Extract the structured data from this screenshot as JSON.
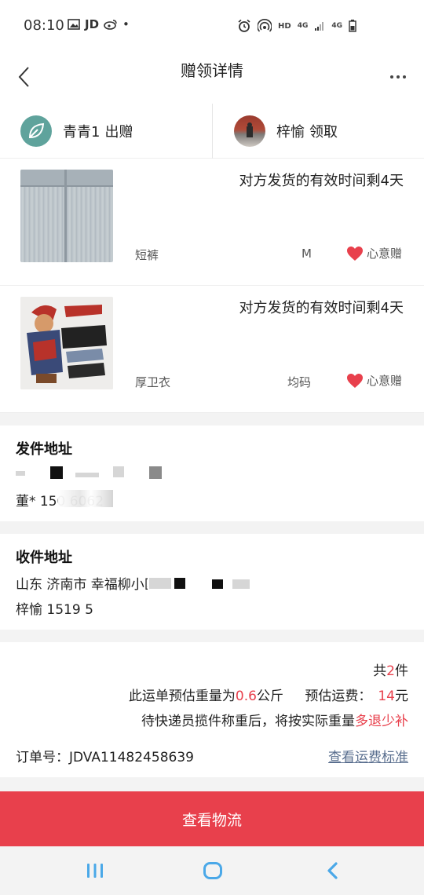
{
  "status_bar": {
    "time": "08:10",
    "left_icons": [
      "image-icon",
      "JD",
      "weibo-icon",
      "•"
    ],
    "right_icons": [
      "alarm-icon",
      "hotspot-icon",
      "HD",
      "4G",
      "4G",
      "battery-icon"
    ]
  },
  "nav": {
    "title": "赠领详情"
  },
  "giver": {
    "name": "青青1",
    "action": "出赠"
  },
  "receiver": {
    "name": "梓愉",
    "action": "领取"
  },
  "items": [
    {
      "note": "对方发货的有效时间剩4天",
      "name": "短裤",
      "size": "M",
      "tag": "心意赠"
    },
    {
      "note": "对方发货的有效时间剩4天",
      "name": "厚卫衣",
      "size": "均码",
      "tag": "心意赠"
    }
  ],
  "sender": {
    "title": "发件地址",
    "address": "",
    "contact": "董* 150  6062"
  },
  "recipient": {
    "title": "收件地址",
    "address_prefix": "山东 济南市 幸福柳小区17号楼",
    "address_suffix": "201",
    "contact": "梓愉 1519      5"
  },
  "shipping": {
    "count_prefix": "共",
    "count": "2",
    "count_suffix": "件",
    "weight_prefix": "此运单预估重量为",
    "weight": "0.6",
    "weight_unit": "公斤",
    "fee_label": "预估运费：",
    "fee": "14",
    "fee_unit": "元",
    "note_prefix": "待快递员揽件称重后，将按实际重量",
    "note_highlight": "多退少补",
    "order_label": "订单号：",
    "order_no": "JDVA11482458639",
    "freight_link": "查看运费标准"
  },
  "action_button": "查看物流",
  "colors": {
    "accent_red": "#e8404c",
    "link": "#5a6f8f",
    "system_nav": "#4aa8e8"
  }
}
